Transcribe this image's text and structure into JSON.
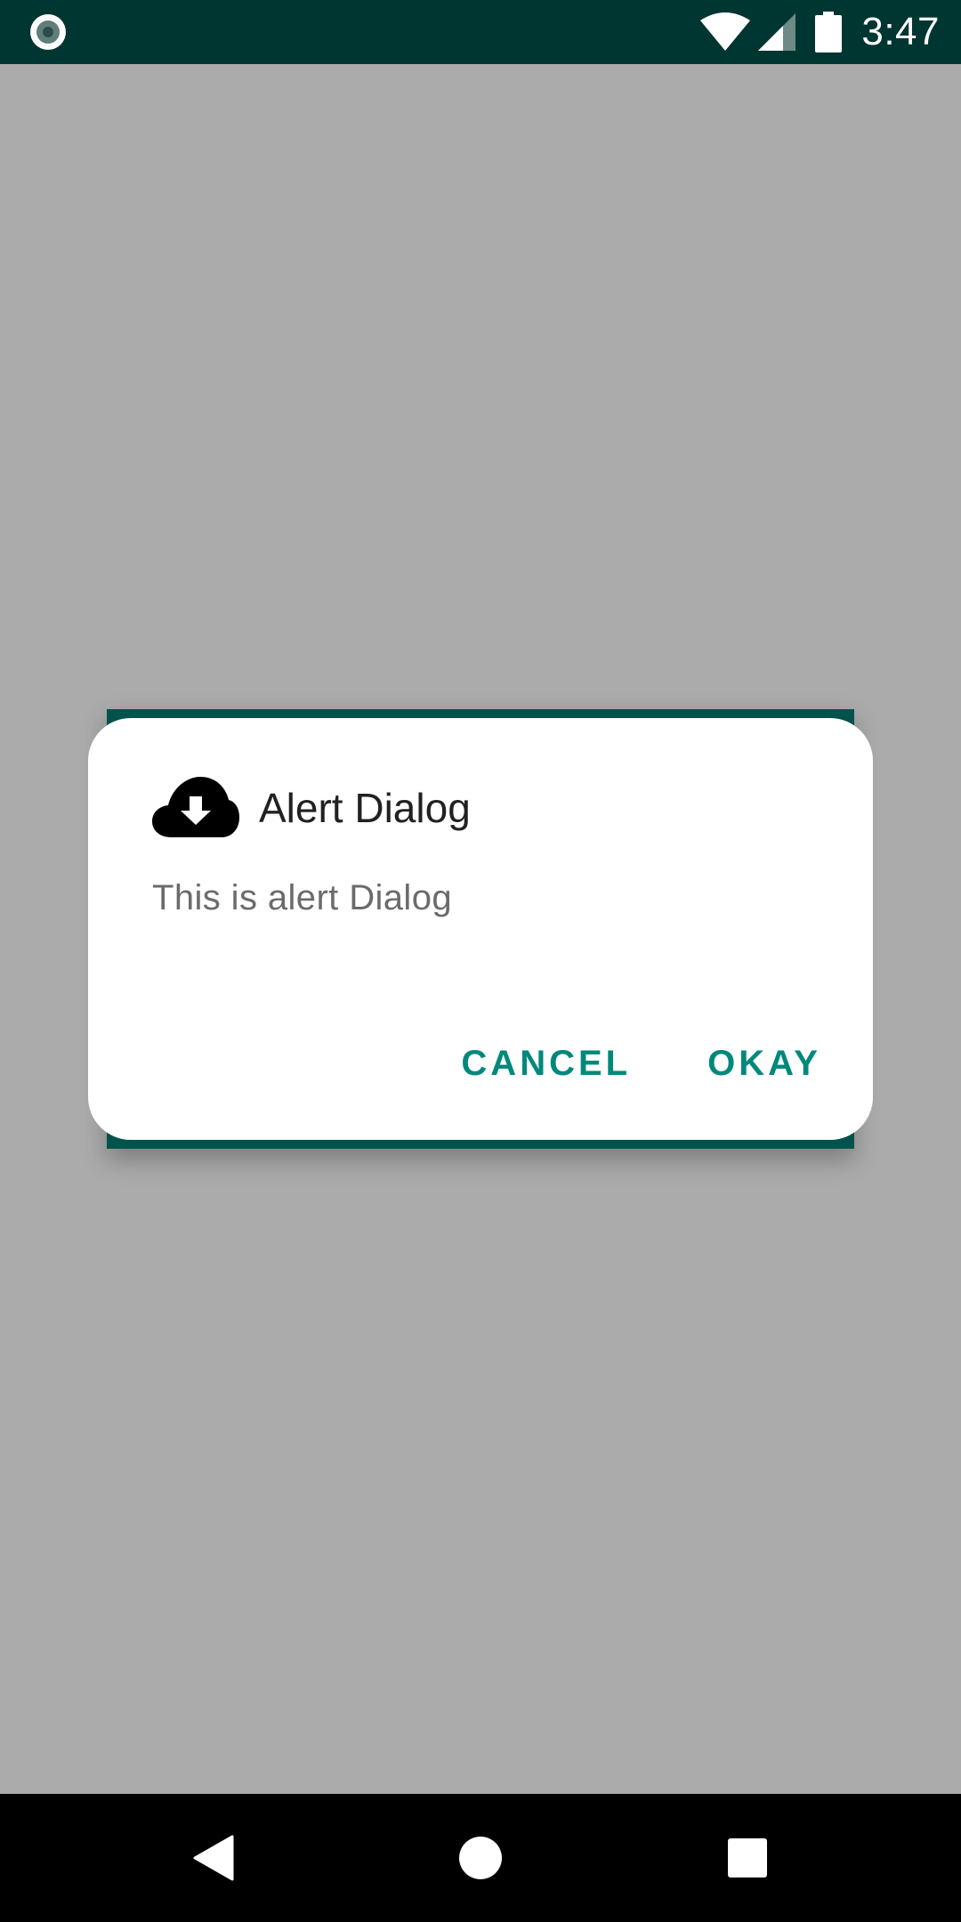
{
  "status_bar": {
    "time": "3:47",
    "left_icon": "circle-record-icon",
    "icons": [
      "wifi-icon",
      "cell-signal-icon",
      "battery-icon"
    ],
    "background_color": "#003632"
  },
  "dialog": {
    "icon": "cloud-download-icon",
    "title": "Alert Dialog",
    "message": "This is alert Dialog",
    "buttons": {
      "cancel": "CANCEL",
      "okay": "OKAY"
    },
    "accent_color": "#00897b"
  },
  "nav_bar": {
    "buttons": [
      "back-icon",
      "home-icon",
      "recents-icon"
    ]
  }
}
